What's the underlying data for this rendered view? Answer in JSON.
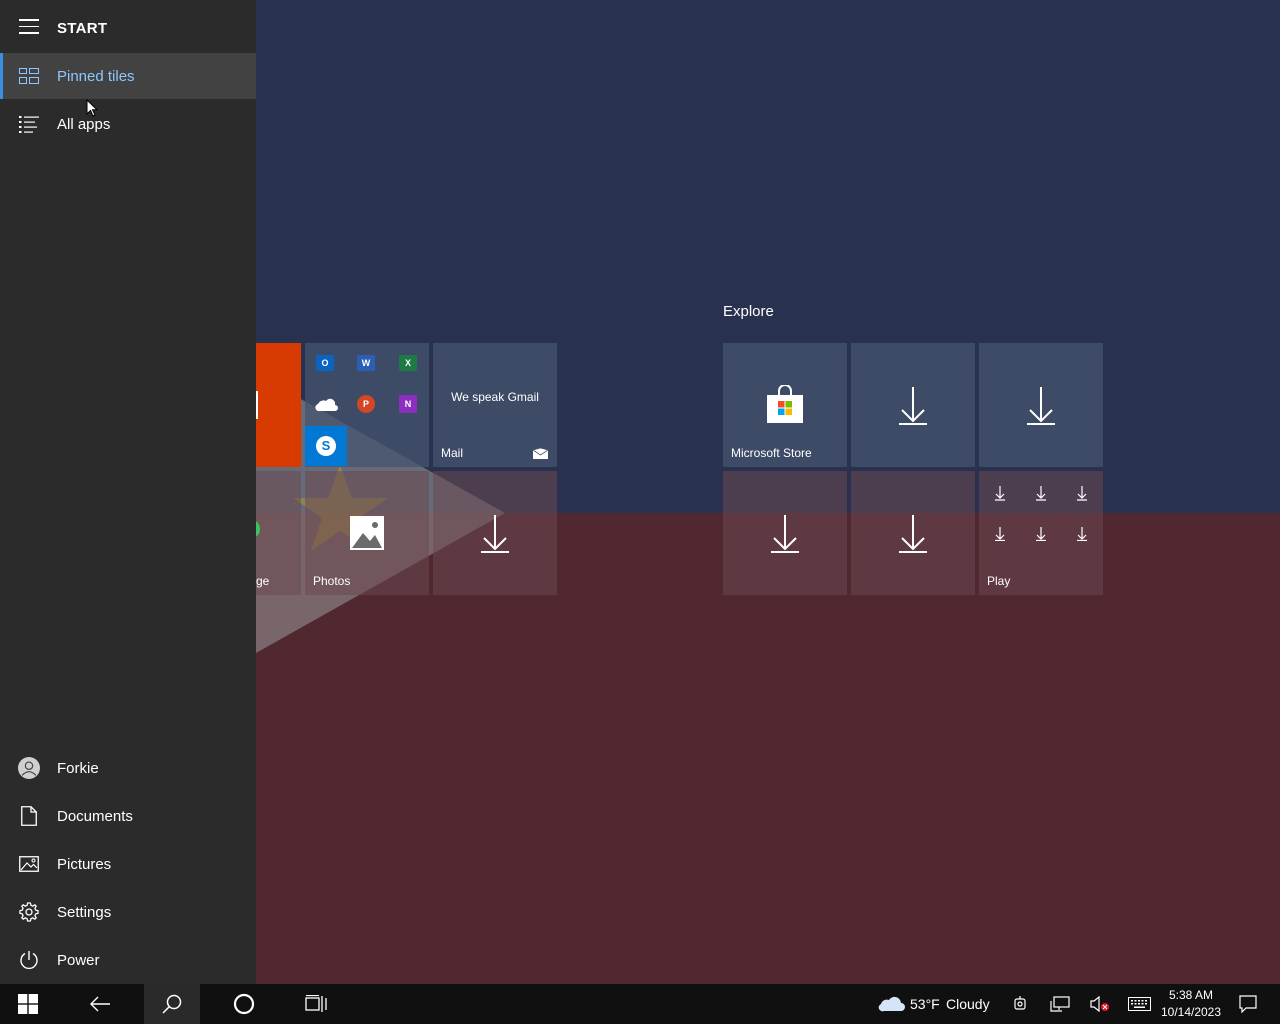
{
  "start": {
    "title": "START",
    "nav": [
      {
        "label": "Pinned tiles",
        "icon": "pinned-tiles-icon",
        "active": true
      },
      {
        "label": "All apps",
        "icon": "list-icon",
        "active": false
      }
    ],
    "bottom": [
      {
        "label": "Forkie",
        "icon": "user-avatar-icon"
      },
      {
        "label": "Documents",
        "icon": "document-icon"
      },
      {
        "label": "Pictures",
        "icon": "pictures-icon"
      },
      {
        "label": "Settings",
        "icon": "gear-icon"
      },
      {
        "label": "Power",
        "icon": "power-icon"
      }
    ]
  },
  "tiles": {
    "mail": {
      "headline": "We speak Gmail",
      "label": "Mail"
    },
    "edge_partial": {
      "label": "ge"
    },
    "photos": {
      "label": "Photos"
    },
    "explore_title": "Explore",
    "store": {
      "label": "Microsoft Store"
    },
    "play": {
      "label": "Play"
    }
  },
  "taskbar": {
    "weather_temp": "53°F",
    "weather_desc": "Cloudy",
    "time": "5:38 AM",
    "date": "10/14/2023"
  },
  "colors": {
    "accent": "#3a8ee6",
    "office_tile": "#d83b01",
    "skype": "#0078d4",
    "flag_blue": "#28324e",
    "flag_red": "#512730"
  }
}
